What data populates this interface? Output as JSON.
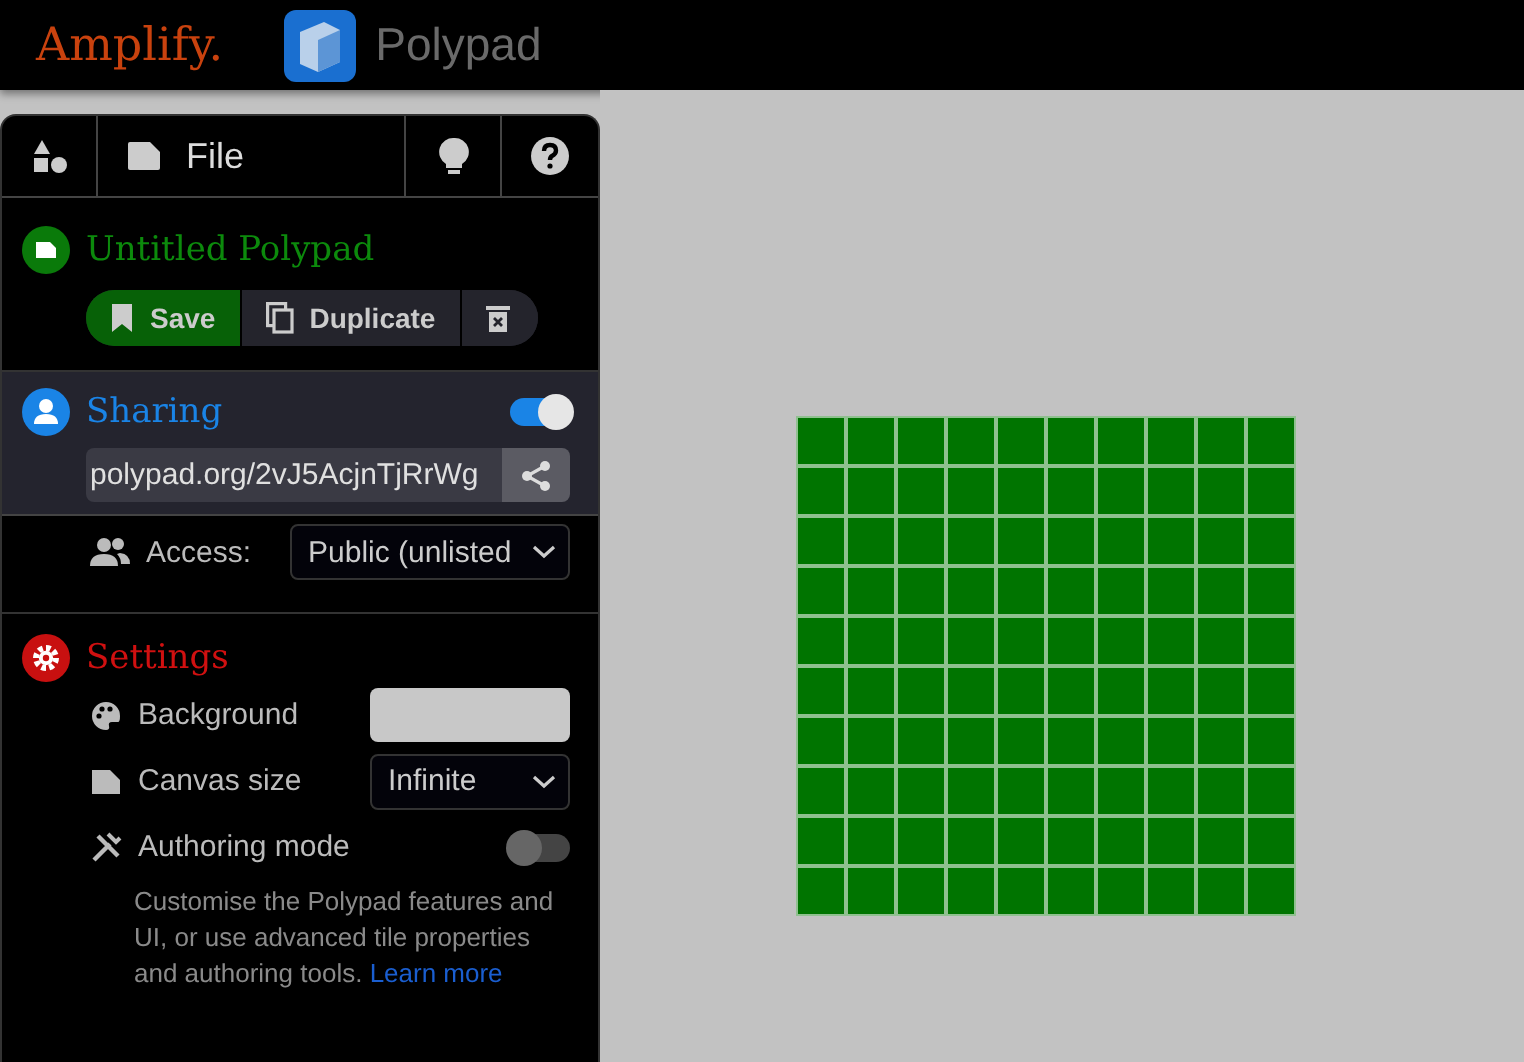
{
  "header": {
    "brand": "Amplify.",
    "app_name": "Polypad"
  },
  "toolbar": [
    {
      "kind": "shapes"
    },
    {
      "kind": "file",
      "label": "File"
    },
    {
      "kind": "idea"
    },
    {
      "kind": "help"
    }
  ],
  "file_section": {
    "title": "Untitled Polypad",
    "buttons": [
      {
        "kind": "save",
        "label": "Save"
      },
      {
        "kind": "duplicate",
        "label": "Duplicate"
      },
      {
        "kind": "delete"
      }
    ]
  },
  "sharing_section": {
    "title": "Sharing",
    "on": true,
    "link": "polypad.org/2vJ5AcjnTjRrWg",
    "access_label": "Access:",
    "access_value": "Public (unlisted"
  },
  "settings_section": {
    "title": "Settings",
    "rows": [
      {
        "kind": "color",
        "label": "Background",
        "color": "#c8c8c8"
      },
      {
        "kind": "select",
        "label": "Canvas size",
        "value": "Infinite"
      },
      {
        "kind": "toggle",
        "label": "Authoring mode",
        "on": false
      }
    ],
    "description": "Customise the Polypad features and UI, or use advanced tile properties and authoring tools.",
    "link": "Learn more"
  }
}
